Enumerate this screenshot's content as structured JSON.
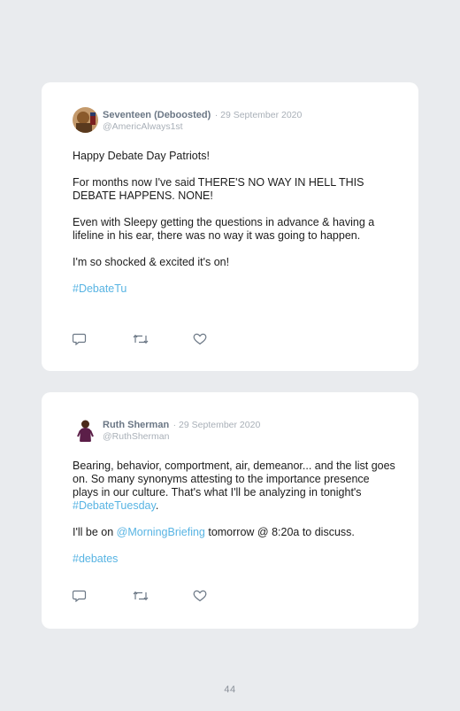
{
  "tweets": [
    {
      "name": "Seventeen (Deboosted)",
      "date": "· 29 September 2020",
      "handle": "@AmericAlways1st",
      "paragraphs": [
        "Happy Debate Day Patriots!",
        "For months now I've said THERE'S NO WAY IN HELL THIS DEBATE HAPPENS. NONE!",
        "Even with Sleepy getting the questions in advance & having a lifeline in his ear, there was no way it was going to happen.",
        "I'm so shocked & excited it's on!"
      ],
      "hashtag": "#DebateTu"
    },
    {
      "name": "Ruth Sherman",
      "date": "· 29 September 2020",
      "handle": "@RuthSherman",
      "p1_text": "Bearing, behavior, comportment, air, demeanor... and the list goes on. So many synonyms attesting to the importance presence plays in our culture. That's what I'll be analyzing in tonight's ",
      "p1_link": "#DebateTuesday",
      "p1_end": ".",
      "p2_start": "I'll be on ",
      "p2_link": "@MorningBriefing",
      "p2_end": " tomorrow @ 8:20a to discuss.",
      "hashtag": "#debates"
    }
  ],
  "page_number": "44",
  "colors": {
    "background": "#e9ebee",
    "card": "#ffffff",
    "link": "#58b4e3",
    "muted": "#a9b0b8"
  },
  "icons": [
    "reply-icon",
    "retweet-icon",
    "like-icon"
  ]
}
